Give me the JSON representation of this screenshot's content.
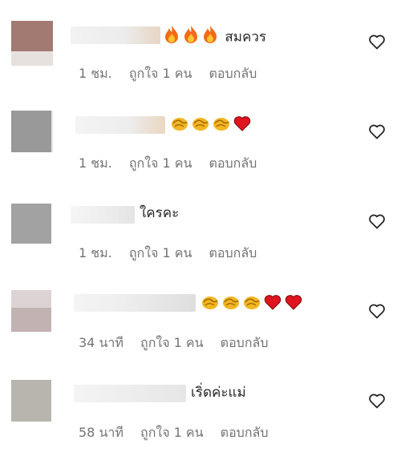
{
  "comments": [
    {
      "text": "สมควร",
      "emojis": [
        "fire",
        "fire",
        "fire"
      ],
      "time": "1 ชม.",
      "likes": "ถูกใจ 1 คน",
      "reply": "ตอบกลับ",
      "avatar_color": "#a87f78"
    },
    {
      "text": "",
      "emojis": [
        "clap",
        "clap",
        "clap",
        "heart"
      ],
      "time": "1 ชม.",
      "likes": "ถูกใจ 1 คน",
      "reply": "ตอบกลับ",
      "avatar_color": "#999999"
    },
    {
      "text": "ใครคะ",
      "emojis": [],
      "time": "1 ชม.",
      "likes": "ถูกใจ 1 คน",
      "reply": "ตอบกลับ",
      "avatar_color": "#a2a2a2"
    },
    {
      "text": "",
      "emojis": [
        "clap",
        "clap",
        "clap",
        "heart",
        "heart"
      ],
      "time": "34 นาที",
      "likes": "ถูกใจ 1 คน",
      "reply": "ตอบกลับ",
      "avatar_color": "#c8bcbc"
    },
    {
      "text": "เริ่ดค่ะแม่",
      "emojis": [],
      "time": "58 นาที",
      "likes": "ถูกใจ 1 คน",
      "reply": "ตอบกลับ",
      "avatar_color": "#b8b4ae"
    }
  ],
  "colors": {
    "meta_text": "#737373",
    "body_text": "#262626",
    "heart_outline": "#262626"
  },
  "icons": {
    "like": "heart-outline-icon"
  }
}
